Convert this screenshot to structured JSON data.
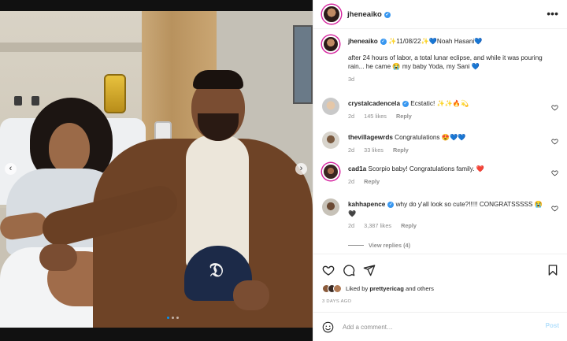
{
  "post": {
    "username": "jheneaiko",
    "verified_icon": "verified-badge-icon",
    "caption_line1": "✨11/08/22✨💙Noah Hasani💙",
    "caption_line2": "after 24 hours of labor, a total lunar eclipse, and while it was pouring rain... he came 😭 my baby Yoda, my Sani 💙",
    "caption_time": "3d"
  },
  "comments": [
    {
      "username": "crystalcadencela",
      "verified": true,
      "text": "Ecstatic! ✨✨🔥💫",
      "time": "2d",
      "likes": "145 likes",
      "reply": "Reply"
    },
    {
      "username": "thevillagewrds",
      "verified": false,
      "text": "Congratulations 😍💙💙",
      "time": "2d",
      "likes": "33 likes",
      "reply": "Reply"
    },
    {
      "username": "cad1a",
      "verified": false,
      "text": "Scorpio baby! Congratulations family. ❤️",
      "time": "2d",
      "likes": "",
      "reply": "Reply"
    },
    {
      "username": "kahhapence",
      "verified": true,
      "text": "why do y'all look so cute?!!!!! CONGRATSSSSS 😭🖤",
      "time": "2d",
      "likes": "3,387 likes",
      "reply": "Reply"
    }
  ],
  "view_replies": "View replies (4)",
  "liked_by": {
    "prefix": "Liked by",
    "user": "prettyericag",
    "suffix": "and others"
  },
  "date": "3 DAYS AGO",
  "comment_box": {
    "placeholder": "Add a comment…",
    "post_label": "Post"
  },
  "colors": {
    "accent": "#0095f6",
    "muted": "#8e8e8e",
    "text": "#262626",
    "verified": "#3897f0"
  },
  "icons": [
    "more-icon",
    "heart-icon",
    "comment-icon",
    "share-icon",
    "bookmark-icon",
    "emoji-icon",
    "prev-arrow-icon",
    "next-arrow-icon"
  ]
}
